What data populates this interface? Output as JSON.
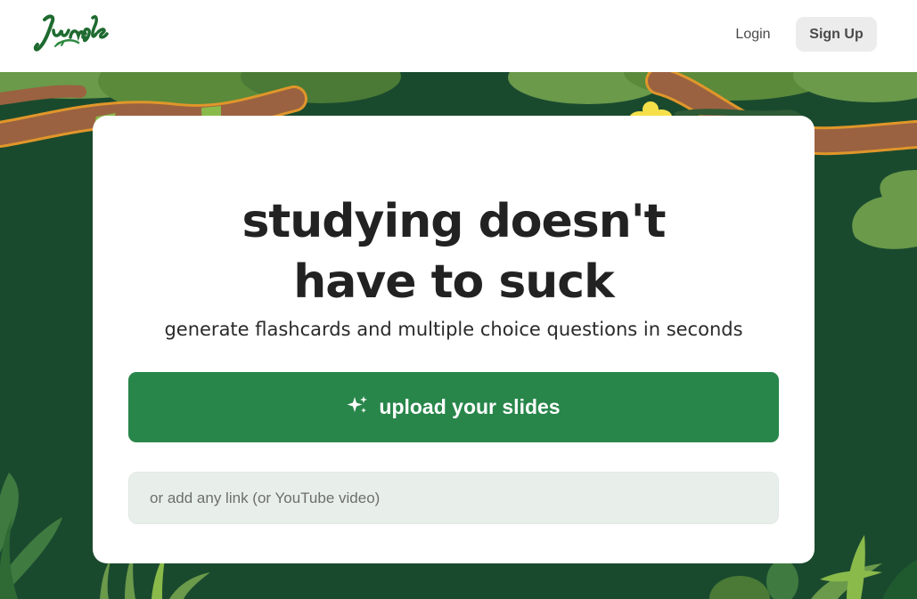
{
  "header": {
    "logo_text": "Jungle",
    "logo_icon": "jungle-script-logo",
    "login_label": "Login",
    "signup_label": "Sign Up"
  },
  "hero": {
    "headline_line1": "studying doesn't",
    "headline_line2": "have to suck",
    "subheadline": "generate flashcards and multiple choice questions in seconds",
    "upload_label": "upload your slides",
    "upload_icon": "sparkle-icon",
    "link_placeholder": "or add any link (or YouTube video)",
    "link_value": ""
  },
  "colors": {
    "brand_green": "#28864a",
    "jungle_dark": "#1a4a2e",
    "leaf_light": "#6a9a4a",
    "vine_brown": "#9a6240",
    "flower_yellow": "#f5e04a"
  }
}
